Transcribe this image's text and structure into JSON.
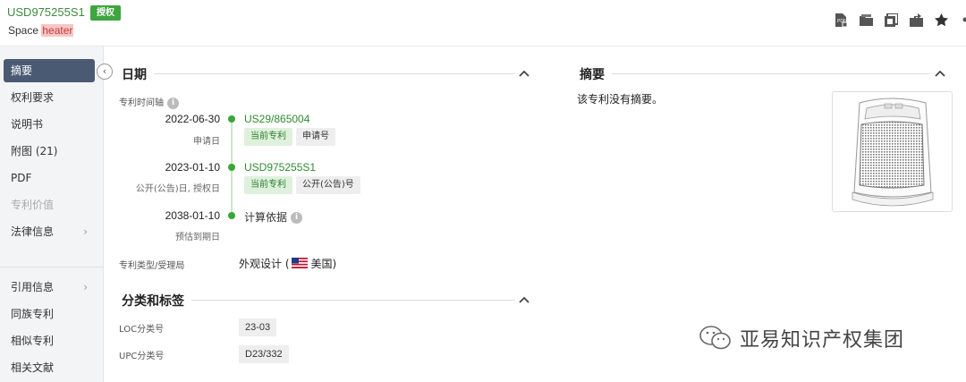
{
  "header": {
    "patent_number": "USD975255S1",
    "status_badge": "授权",
    "title_prefix": "Space ",
    "title_highlight": "heater",
    "icons": [
      "pdf-icon",
      "folder-icon",
      "copy-icon",
      "export-icon",
      "star-icon",
      "share-icon"
    ]
  },
  "sidebar": {
    "items": [
      {
        "label": "摘要",
        "active": true
      },
      {
        "label": "权利要求"
      },
      {
        "label": "说明书"
      },
      {
        "label": "附图 (21)"
      },
      {
        "label": "PDF"
      },
      {
        "label": "专利价值",
        "disabled": true
      },
      {
        "label": "法律信息",
        "arrow": "›"
      },
      {
        "label": "引用信息",
        "arrow": "›"
      },
      {
        "label": "同族专利"
      },
      {
        "label": "相似专利"
      },
      {
        "label": "相关文献"
      }
    ]
  },
  "dates": {
    "section_title": "日期",
    "timeline_label": "专利时间轴",
    "entries": [
      {
        "date": "2022-06-30",
        "sub": "申请日",
        "link": "US29/865004",
        "tags": [
          "当前专利",
          "申请号"
        ]
      },
      {
        "date": "2023-01-10",
        "sub": "公开(公告)日, 授权日",
        "link": "USD975255S1",
        "tags": [
          "当前专利",
          "公开(公告)号"
        ]
      },
      {
        "date": "2038-01-10",
        "sub": "预估到期日",
        "text": "计算依据"
      }
    ],
    "type_label": "专利类型/受理局",
    "type_value": "外观设计 (",
    "type_country": "美国)"
  },
  "classification": {
    "section_title": "分类和标签",
    "loc_label": "LOC分类号",
    "loc_value": "23-03",
    "upc_label": "UPC分类号",
    "upc_value": "D23/332"
  },
  "abstract": {
    "section_title": "摘要",
    "text": "该专利没有摘要。"
  },
  "watermark": {
    "text": "亚易知识产权集团"
  },
  "colors": {
    "accent_green": "#3fa53f",
    "sidebar_active": "#4a5a73",
    "highlight": "#f6c6c6"
  }
}
